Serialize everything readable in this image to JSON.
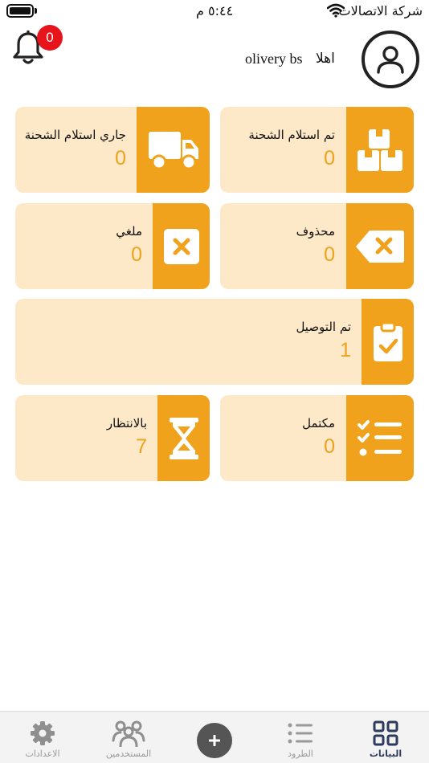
{
  "status_bar": {
    "carrier": "شركة الاتصالات",
    "time": "٥:٤٤ م"
  },
  "header": {
    "notification_count": "0",
    "greeting": "اهلا",
    "user_name": "olivery bs"
  },
  "cards": {
    "received": {
      "label": "تم استلام الشحنة",
      "count": "0",
      "icon": "boxes-icon"
    },
    "receiving": {
      "label": "جاري استلام الشحنة",
      "count": "0",
      "icon": "truck-icon"
    },
    "deleted": {
      "label": "محذوف",
      "count": "0",
      "icon": "backspace-x-icon"
    },
    "cancelled": {
      "label": "ملغي",
      "count": "0",
      "icon": "x-square-icon"
    },
    "delivered": {
      "label": "تم التوصيل",
      "count": "1",
      "icon": "clipboard-check-icon"
    },
    "completed": {
      "label": "مكتمل",
      "count": "0",
      "icon": "checklist-icon"
    },
    "waiting": {
      "label": "بالانتظار",
      "count": "7",
      "icon": "hourglass-icon"
    }
  },
  "nav": {
    "data": "البيانات",
    "parcels": "الطرود",
    "users": "المستخدمين",
    "settings": "الاعدادات"
  },
  "colors": {
    "accent": "#f0a21c",
    "card_bg": "#fde8c7",
    "count": "#eea11d",
    "badge": "#e8141c",
    "nav_active": "#2c3a5c"
  }
}
